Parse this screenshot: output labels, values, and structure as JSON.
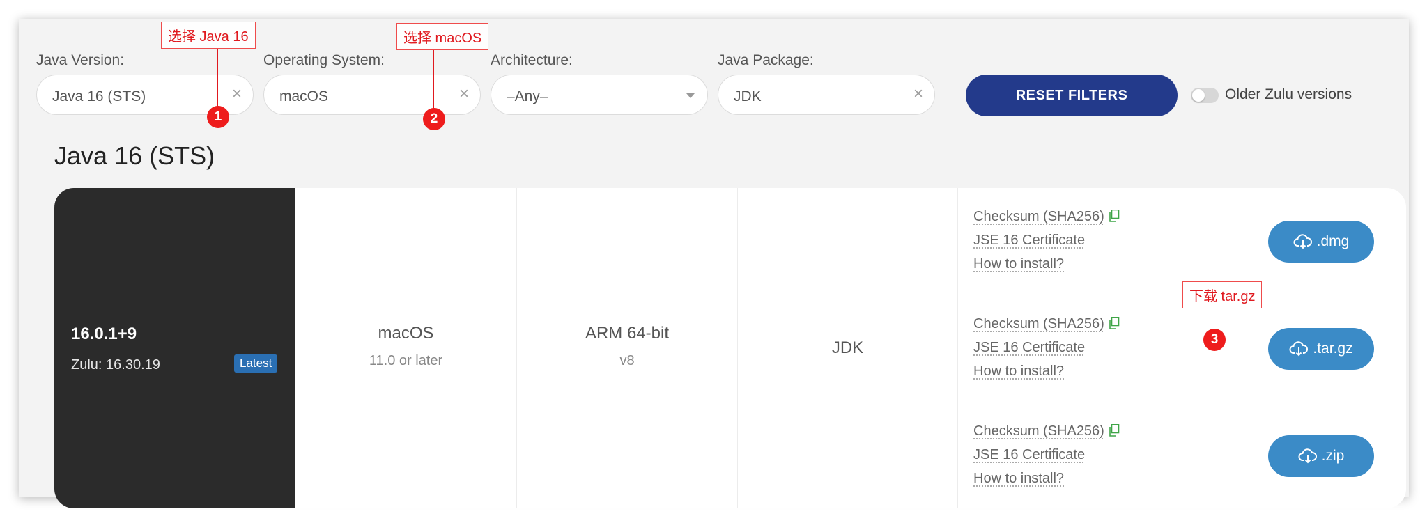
{
  "filters": {
    "java_version": {
      "label": "Java Version:",
      "value": "Java 16 (STS)",
      "clear": "×"
    },
    "operating_system": {
      "label": "Operating System:",
      "value": "macOS",
      "clear": "×"
    },
    "architecture": {
      "label": "Architecture:",
      "value": "–Any–"
    },
    "java_package": {
      "label": "Java Package:",
      "value": "JDK",
      "clear": "×"
    }
  },
  "reset_label": "RESET FILTERS",
  "older_toggle": {
    "label": "Older Zulu versions",
    "on": false
  },
  "section_title": "Java 16 (STS)",
  "release": {
    "version": "16.0.1+9",
    "zulu": "Zulu: 16.30.19",
    "badge": "Latest",
    "os": "macOS",
    "os_detail": "11.0 or later",
    "arch": "ARM 64-bit",
    "arch_detail": "v8",
    "package": "JDK"
  },
  "downloads": [
    {
      "checksum": "Checksum (SHA256)",
      "certificate": "JSE 16 Certificate",
      "install": "How to install?",
      "button": ".dmg"
    },
    {
      "checksum": "Checksum (SHA256)",
      "certificate": "JSE 16 Certificate",
      "install": "How to install?",
      "button": ".tar.gz"
    },
    {
      "checksum": "Checksum (SHA256)",
      "certificate": "JSE 16 Certificate",
      "install": "How to install?",
      "button": ".zip"
    }
  ],
  "annotations": [
    {
      "text": "选择 Java 16",
      "number": "1"
    },
    {
      "text": "选择 macOS",
      "number": "2"
    },
    {
      "text": "下载 tar.gz",
      "number": "3"
    }
  ],
  "colors": {
    "reset_button": "#233a8b",
    "download_button": "#3b8bc7",
    "latest_badge": "#2a6fb3",
    "dark_panel": "#2b2b2b",
    "annotation_red": "#e0191f",
    "copy_icon": "#3fa548"
  },
  "icons": {
    "copy": "copy-icon",
    "download": "cloud-download-icon",
    "clear": "close-icon",
    "dropdown": "chevron-down-icon"
  }
}
